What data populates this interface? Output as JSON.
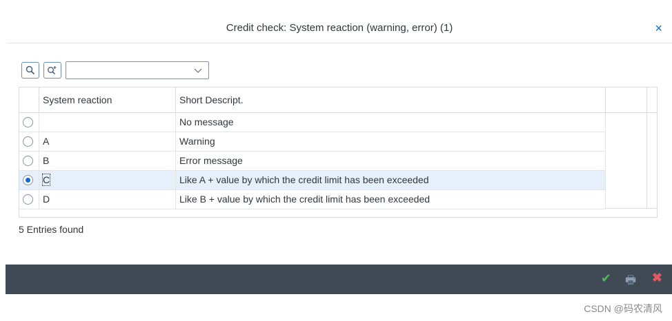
{
  "dialog": {
    "title": "Credit check: System reaction (warning, error) (1)",
    "close_icon": "×"
  },
  "toolbar": {
    "search_icon": "search-icon",
    "search_plus_icon": "search-plus-icon",
    "dropdown_value": ""
  },
  "table": {
    "headers": [
      "System reaction",
      "Short Descript."
    ],
    "rows": [
      {
        "code": "",
        "desc": "No message",
        "selected": false
      },
      {
        "code": "A",
        "desc": "Warning",
        "selected": false
      },
      {
        "code": "B",
        "desc": "Error message",
        "selected": false
      },
      {
        "code": "C",
        "desc": "Like A + value by which the credit limit has been exceeded",
        "selected": true
      },
      {
        "code": "D",
        "desc": "Like B + value by which the credit limit has been exceeded",
        "selected": false
      }
    ]
  },
  "status": {
    "entries": "5 Entries found"
  },
  "footer": {
    "ok_icon": "✔",
    "print_icon": "🖶",
    "cancel_icon": "✖"
  },
  "watermark": "CSDN @码农清风",
  "colors": {
    "footer_bg": "#3f4a55",
    "accent": "#0a6ed1",
    "selected_row": "#e5f0fa",
    "ok": "#4fb85b",
    "cancel": "#e9545f"
  }
}
